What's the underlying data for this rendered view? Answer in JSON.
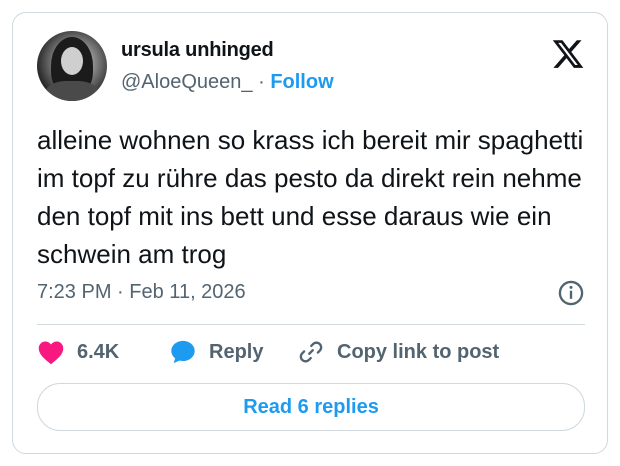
{
  "author": {
    "display_name": "ursula unhinged",
    "handle": "@AloeQueen_",
    "separator": "·",
    "follow_label": "Follow"
  },
  "tweet": {
    "text": "alleine wohnen so krass ich bereit mir spaghetti im topf zu rühre das pesto da direkt rein nehme den topf mit ins bett und esse daraus wie ein schwein am trog",
    "time": "7:23 PM",
    "date_separator": "·",
    "date": "Feb 11, 2026"
  },
  "actions": {
    "like_count": "6.4K",
    "reply_label": "Reply",
    "copy_label": "Copy link to post"
  },
  "read_replies_label": "Read 6 replies",
  "icons": {
    "platform": "x-logo-icon",
    "like": "heart-icon",
    "reply": "speech-bubble-icon",
    "copy": "link-icon",
    "info": "info-icon"
  },
  "colors": {
    "accent": "#1d9bf0",
    "like": "#f91880",
    "muted": "#536471",
    "text": "#0f1419",
    "border": "#cfd9de"
  }
}
